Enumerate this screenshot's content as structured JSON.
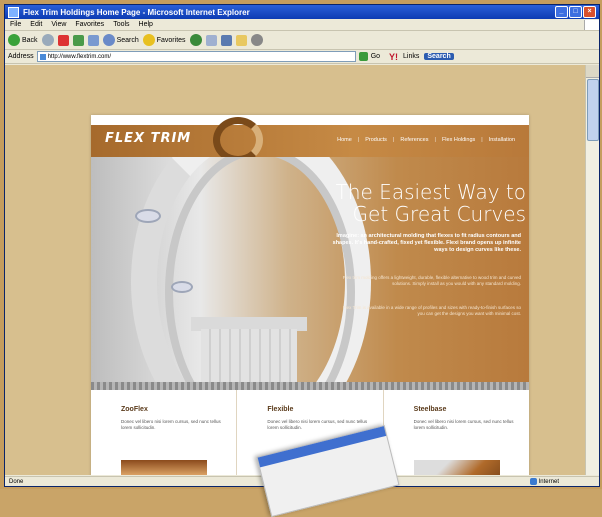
{
  "window": {
    "title": "Flex Trim Holdings Home Page - Microsoft Internet Explorer",
    "buttons": [
      "_",
      "□",
      "×"
    ]
  },
  "menu": [
    "File",
    "Edit",
    "View",
    "Favorites",
    "Tools",
    "Help"
  ],
  "toolbar": {
    "back_label": "Back",
    "search_label": "Search",
    "favorites_label": "Favorites"
  },
  "address": {
    "label": "Address",
    "url": "http://www.flextrim.com/",
    "go_label": "Go",
    "links_label": "Links",
    "search_button": "Search",
    "y_label": "Y!"
  },
  "status": {
    "left": "Done",
    "zone": "Internet"
  },
  "site": {
    "brand": "FLEX TRIM",
    "nav": [
      "Home",
      "Products",
      "References",
      "Flex Holdings",
      "Installation"
    ],
    "headline_1": "The Easiest Way to",
    "headline_2": "Get Great Curves",
    "intro": "Imagine: an architectural molding that flexes to fit radius contours and shapes. It's hand-crafted, fixed yet flexible. Flexi brand opens up infinite ways to design curves like these.",
    "para1": "Flex trim molding offers a lightweight, durable, flexible alternative to wood trim and curved solutions. Simply install as you would with any standard molding.",
    "para2": "Flex Trim is available in a wide range of profiles and sizes with ready-to-finish surfaces so you can get the designs you want with minimal cost.",
    "columns": [
      {
        "title": "ZooFlex",
        "text": "Donec vel libero nisi lorem cursus, sed nunc tellus lorem sollicitudin."
      },
      {
        "title": "Flexible",
        "text": "Donec vel libero nisi lorem cursus, sed nunc tellus lorem sollicitudin."
      },
      {
        "title": "Steelbase",
        "text": "Donec vel libero nisi lorem cursus, sed nunc tellus lorem sollicitudin."
      }
    ]
  },
  "colors": {
    "brand": "#b8793a",
    "titlebar": "#0c3bb3"
  }
}
